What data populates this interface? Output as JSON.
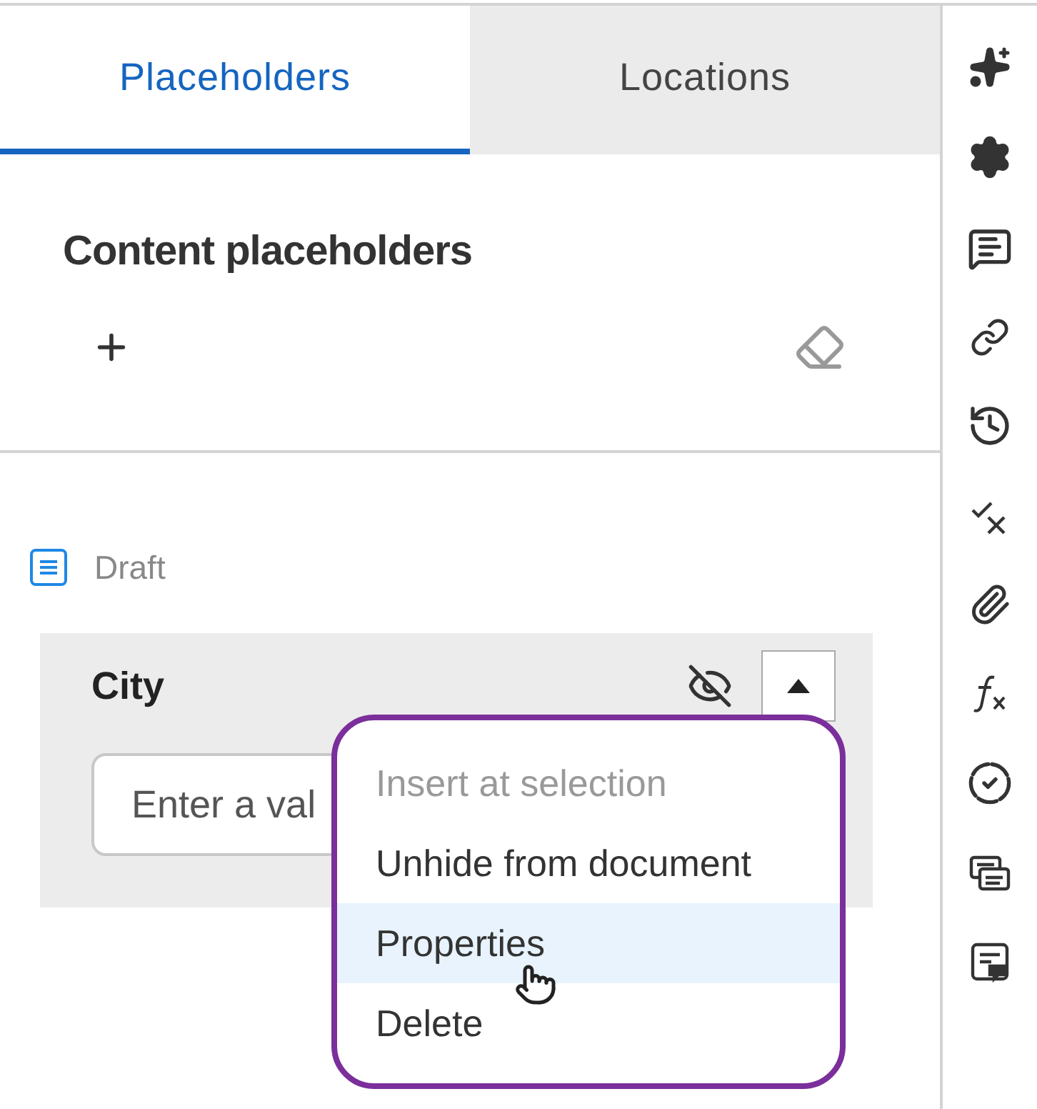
{
  "tabs": [
    {
      "label": "Placeholders",
      "selected": true
    },
    {
      "label": "Locations",
      "selected": false
    }
  ],
  "section": {
    "title": "Content placeholders"
  },
  "group": {
    "label": "Draft"
  },
  "placeholder": {
    "label": "City",
    "hidden": true,
    "expanded": true,
    "field": {
      "placeholder": "Enter a val"
    }
  },
  "menu": [
    {
      "label": "Insert at selection",
      "disabled": true,
      "selected": false
    },
    {
      "label": "Unhide from document",
      "disabled": false,
      "selected": false
    },
    {
      "label": "Properties",
      "disabled": false,
      "selected": true
    },
    {
      "label": "Delete",
      "disabled": false,
      "selected": false
    }
  ]
}
